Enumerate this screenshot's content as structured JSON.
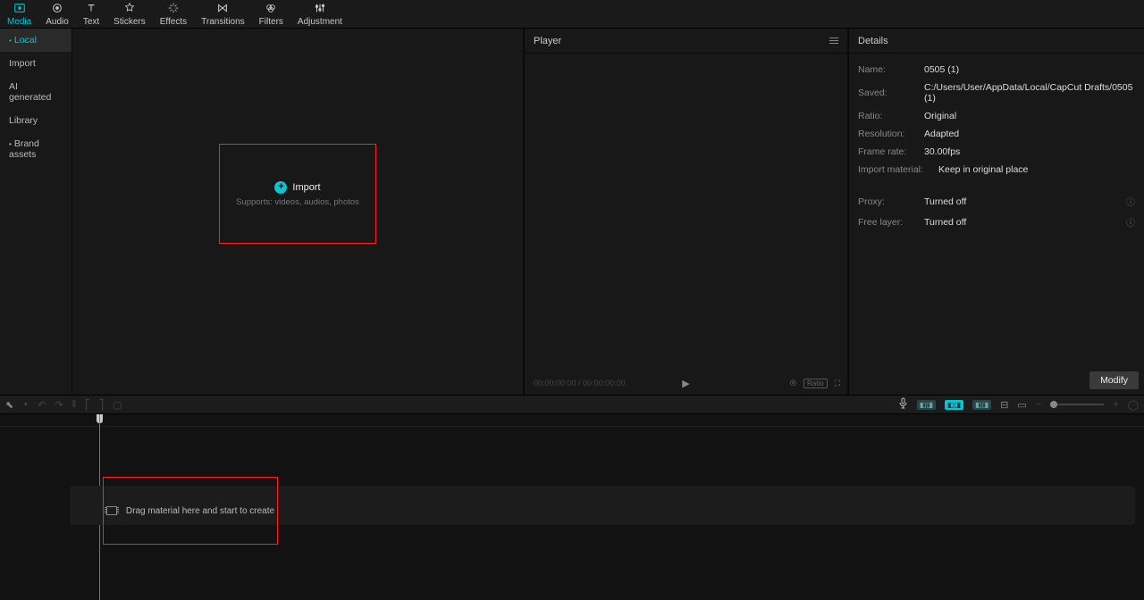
{
  "toolbar": [
    {
      "id": "media",
      "label": "Media",
      "active": true
    },
    {
      "id": "audio",
      "label": "Audio"
    },
    {
      "id": "text",
      "label": "Text"
    },
    {
      "id": "stickers",
      "label": "Stickers"
    },
    {
      "id": "effects",
      "label": "Effects"
    },
    {
      "id": "transitions",
      "label": "Transitions"
    },
    {
      "id": "filters",
      "label": "Filters"
    },
    {
      "id": "adjustment",
      "label": "Adjustment"
    }
  ],
  "sidebar": [
    {
      "id": "local",
      "label": "Local",
      "active": true,
      "dot": true
    },
    {
      "id": "import",
      "label": "Import"
    },
    {
      "id": "ai",
      "label": "AI generated"
    },
    {
      "id": "library",
      "label": "Library"
    },
    {
      "id": "brand",
      "label": "Brand assets",
      "dot": true
    }
  ],
  "import_box": {
    "title": "Import",
    "subtitle": "Supports: videos, audios, photos"
  },
  "player": {
    "title": "Player",
    "time": "00:00:00:00 / 00:00:00:00",
    "ratio": "Ratio"
  },
  "details": {
    "title": "Details",
    "rows": [
      {
        "label": "Name:",
        "value": "0505 (1)"
      },
      {
        "label": "Saved:",
        "value": "C:/Users/User/AppData/Local/CapCut Drafts/0505 (1)"
      },
      {
        "label": "Ratio:",
        "value": "Original"
      },
      {
        "label": "Resolution:",
        "value": "Adapted"
      },
      {
        "label": "Frame rate:",
        "value": "30.00fps"
      },
      {
        "label": "Import material:",
        "value": "Keep in original place"
      }
    ],
    "rows2": [
      {
        "label": "Proxy:",
        "value": "Turned off",
        "info": true
      },
      {
        "label": "Free layer:",
        "value": "Turned off",
        "info": true
      }
    ],
    "modify": "Modify"
  },
  "timeline": {
    "drag_text": "Drag material here and start to create"
  }
}
